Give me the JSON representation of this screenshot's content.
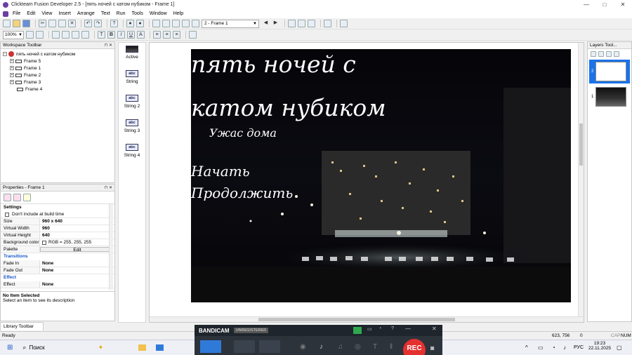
{
  "window": {
    "title": "Clickteam Fusion Developer 2.5 - [пять ночей с катом нубиком - Frame 1]",
    "minimize": "—",
    "maximize": "□",
    "close": "✕"
  },
  "menu": [
    "File",
    "Edit",
    "View",
    "Insert",
    "Arrange",
    "Text",
    "Run",
    "Tools",
    "Window",
    "Help"
  ],
  "toolbar": {
    "frame_select": "2 - Frame 1",
    "zoom": "100%"
  },
  "workspace": {
    "title": "Workspace Toolbar",
    "app_name": "пять ночей с катом нубиком",
    "frames": [
      "Frame 5",
      "Frame 1",
      "Frame 2",
      "Frame 3",
      "Frame 4"
    ]
  },
  "properties": {
    "title": "Properties - Frame 1",
    "section_settings": "Settings",
    "dont_include": "Don't include at build time",
    "rows": [
      {
        "k": "Size",
        "v": "960 x 640"
      },
      {
        "k": "Virtual Width",
        "v": "960"
      },
      {
        "k": "Virtual Height",
        "v": "640"
      },
      {
        "k": "Background color",
        "v": "RGB = 255, 255, 255"
      },
      {
        "k": "Palette",
        "v": "Edit"
      }
    ],
    "section_transitions": "Transitions",
    "transitions": [
      {
        "k": "Fade In",
        "v": "None"
      },
      {
        "k": "Fade Out",
        "v": "None"
      }
    ],
    "section_effect": "Effect",
    "effect": {
      "k": "Effect",
      "v": "None"
    },
    "info_title": "No Item Selected",
    "info_text": "Select an item to see its description"
  },
  "objects": [
    {
      "label": "Active",
      "icon": "active-icon"
    },
    {
      "label": "String",
      "icon": "abc"
    },
    {
      "label": "String 2",
      "icon": "abc"
    },
    {
      "label": "String 3",
      "icon": "abc"
    },
    {
      "label": "String 4",
      "icon": "abc"
    }
  ],
  "frame_texts": {
    "title_line1": "пять ночей с",
    "title_line2": "катом нубиком",
    "subtitle": "Ужас дома",
    "start": "Начать",
    "continue": "Продолжить"
  },
  "layers": {
    "title": "Layers Tool...",
    "items": [
      {
        "num": "2"
      },
      {
        "num": "1"
      }
    ]
  },
  "library": {
    "tab": "Library Toolbar"
  },
  "status": {
    "ready": "Ready",
    "coords": "623, 756",
    "layer": "0",
    "caps": "CAP",
    "num": "NUM"
  },
  "taskbar": {
    "search": "Поиск",
    "lang": "РУС",
    "time": "19:23",
    "date": "22.11.2025"
  },
  "bandicam": {
    "logo": "BANDICAM",
    "unregistered": "UNREGISTERED",
    "rec": "REC"
  },
  "colors": {
    "accent": "#1a55c7",
    "rec": "#e53030"
  }
}
